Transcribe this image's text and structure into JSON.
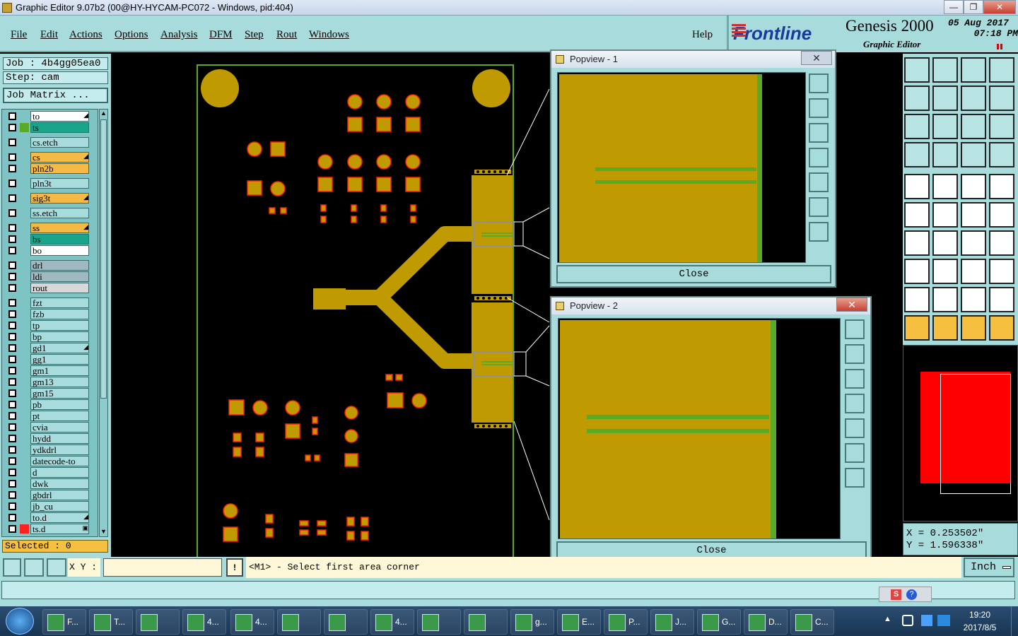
{
  "window": {
    "title": "Graphic Editor 9.07b2 (00@HY-HYCAM-PC072 - Windows, pid:404)",
    "minimize": "—",
    "maximize": "❐",
    "close": "✕"
  },
  "menu": [
    "File",
    "Edit",
    "Actions",
    "Options",
    "Analysis",
    "DFM",
    "Step",
    "Rout",
    "Windows"
  ],
  "help_label": "Help",
  "brand": {
    "logo": "Frontline",
    "product": "Genesis 2000",
    "subtitle": "Graphic Editor",
    "date": "05 Aug 2017",
    "time": "07:18 PM"
  },
  "job": {
    "job_line": "Job : 4b4gg05ea0",
    "step_line": "Step: cam",
    "matrix_button": "Job Matrix ..."
  },
  "layers": [
    {
      "name": "to",
      "color": "#ffffff",
      "swatch": "",
      "mark": "◢"
    },
    {
      "name": "ts",
      "color": "#1aa58a",
      "swatch": "#5aaa2a",
      "mark": ""
    },
    {
      "name": "cs.etch",
      "color": "#a8dcdc",
      "swatch": "",
      "mark": ""
    },
    {
      "name": "cs",
      "color": "#f5b946",
      "swatch": "",
      "mark": "◢"
    },
    {
      "name": "pln2b",
      "color": "#f5b946",
      "swatch": "",
      "mark": ""
    },
    {
      "name": "pln3t",
      "color": "#a8dcdc",
      "swatch": "",
      "mark": ""
    },
    {
      "name": "sig3t",
      "color": "#f5b946",
      "swatch": "",
      "mark": "◢"
    },
    {
      "name": "ss.etch",
      "color": "#a8dcdc",
      "swatch": "",
      "mark": ""
    },
    {
      "name": "ss",
      "color": "#f5b946",
      "swatch": "",
      "mark": "◢"
    },
    {
      "name": "bs",
      "color": "#1aa58a",
      "swatch": "",
      "mark": ""
    },
    {
      "name": "bo",
      "color": "#ffffff",
      "swatch": "",
      "mark": ""
    },
    {
      "name": "drl",
      "color": "#a0b8c0",
      "swatch": "",
      "mark": ""
    },
    {
      "name": "ldi",
      "color": "#a0b8c0",
      "swatch": "",
      "mark": ""
    },
    {
      "name": "rout",
      "color": "#d8d8d8",
      "swatch": "",
      "mark": ""
    },
    {
      "name": "fzt",
      "color": "#a8dcdc",
      "swatch": "",
      "mark": ""
    },
    {
      "name": "fzb",
      "color": "#a8dcdc",
      "swatch": "",
      "mark": ""
    },
    {
      "name": "tp",
      "color": "#a8dcdc",
      "swatch": "",
      "mark": ""
    },
    {
      "name": "bp",
      "color": "#a8dcdc",
      "swatch": "",
      "mark": ""
    },
    {
      "name": "gd1",
      "color": "#a8dcdc",
      "swatch": "",
      "mark": "◢"
    },
    {
      "name": "gg1",
      "color": "#a8dcdc",
      "swatch": "",
      "mark": ""
    },
    {
      "name": "gm1",
      "color": "#a8dcdc",
      "swatch": "",
      "mark": ""
    },
    {
      "name": "gm13",
      "color": "#a8dcdc",
      "swatch": "",
      "mark": ""
    },
    {
      "name": "gm15",
      "color": "#a8dcdc",
      "swatch": "",
      "mark": ""
    },
    {
      "name": "pb",
      "color": "#a8dcdc",
      "swatch": "",
      "mark": ""
    },
    {
      "name": "pt",
      "color": "#a8dcdc",
      "swatch": "",
      "mark": ""
    },
    {
      "name": "cvia",
      "color": "#a8dcdc",
      "swatch": "",
      "mark": ""
    },
    {
      "name": "hydd",
      "color": "#a8dcdc",
      "swatch": "",
      "mark": ""
    },
    {
      "name": "ydkdrl",
      "color": "#a8dcdc",
      "swatch": "",
      "mark": ""
    },
    {
      "name": "datecode-to",
      "color": "#a8dcdc",
      "swatch": "",
      "mark": ""
    },
    {
      "name": "d",
      "color": "#a8dcdc",
      "swatch": "",
      "mark": ""
    },
    {
      "name": "dwk",
      "color": "#a8dcdc",
      "swatch": "",
      "mark": ""
    },
    {
      "name": "gbdrl",
      "color": "#a8dcdc",
      "swatch": "",
      "mark": ""
    },
    {
      "name": "jb_cu",
      "color": "#a8dcdc",
      "swatch": "",
      "mark": ""
    },
    {
      "name": "to.d",
      "color": "#a8dcdc",
      "swatch": "",
      "mark": "◢"
    },
    {
      "name": "ts.d",
      "color": "#a8dcdc",
      "swatch": "#ff2020",
      "mark": "▣"
    }
  ],
  "selected_label": "Selected : 0",
  "popview1": {
    "title": "Popview - 1",
    "close": "Close",
    "x": "✕"
  },
  "popview2": {
    "title": "Popview - 2",
    "close": "Close",
    "x": "✕"
  },
  "coords": {
    "x": "X = 0.253502\"",
    "y": "Y = 1.596338\""
  },
  "command": {
    "xy_label": "X Y :",
    "xy_value": "",
    "warn": "!",
    "prompt": "<M1> - Select first area corner",
    "units": "Inch"
  },
  "colors": {
    "panel": "#a8dcdc",
    "copper": "#bf9a00",
    "pad_outline": "#ff2000",
    "trace_green": "#5aaa2a"
  },
  "taskbar": {
    "items": [
      {
        "label": "F..."
      },
      {
        "label": "T..."
      },
      {
        "label": ""
      },
      {
        "label": "4..."
      },
      {
        "label": "4..."
      },
      {
        "label": ""
      },
      {
        "label": ""
      },
      {
        "label": "4..."
      },
      {
        "label": ""
      },
      {
        "label": ""
      },
      {
        "label": "g..."
      },
      {
        "label": "E..."
      },
      {
        "label": "P..."
      },
      {
        "label": "J..."
      },
      {
        "label": "G..."
      },
      {
        "label": "D..."
      },
      {
        "label": "C..."
      }
    ],
    "time": "19:20",
    "date": "2017/8/5"
  }
}
